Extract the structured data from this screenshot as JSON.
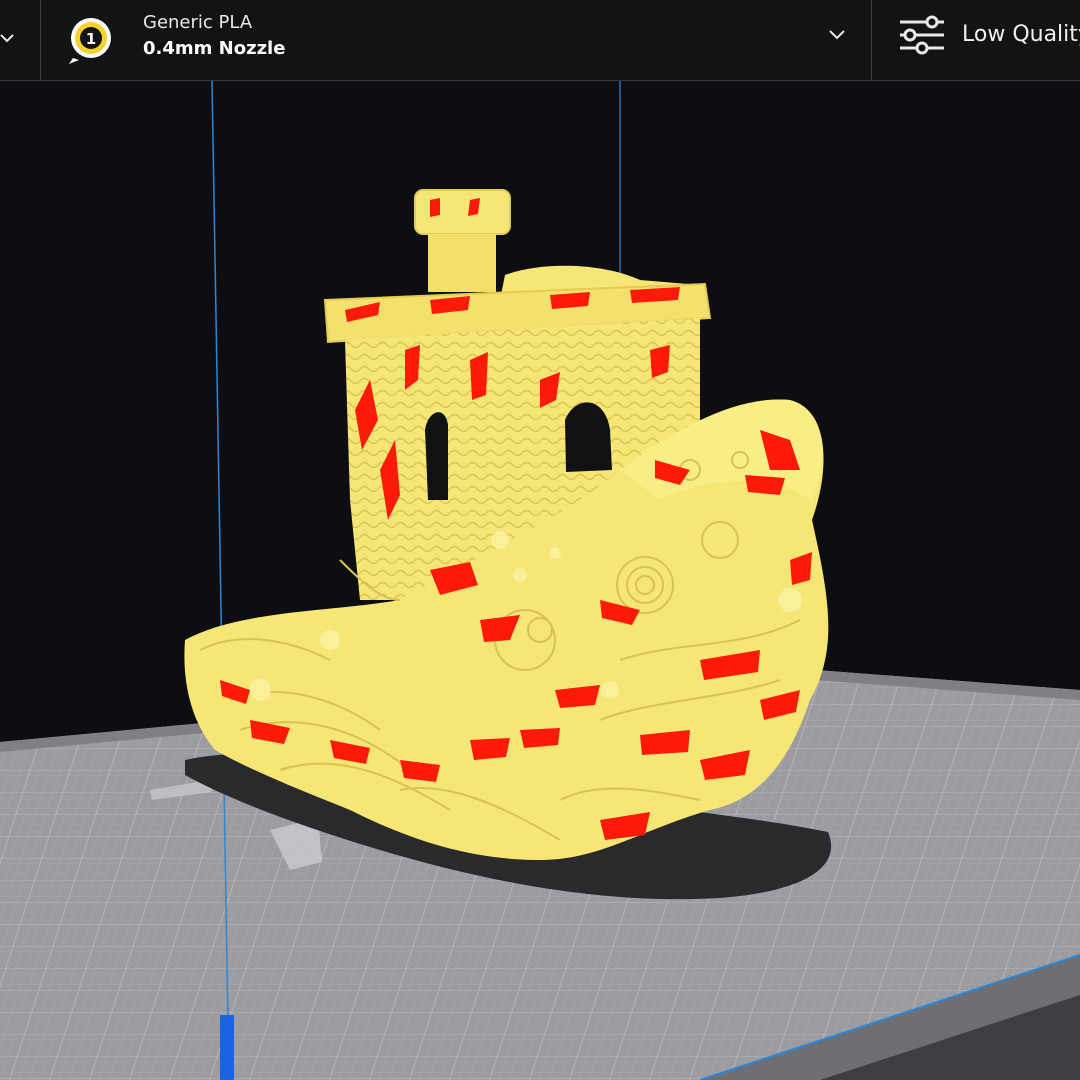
{
  "toolbar": {
    "extruder": {
      "index_label": "1",
      "material_name": "Generic PLA",
      "nozzle_label": "0.4mm Nozzle"
    },
    "quality": {
      "label": "Low Quality",
      "icon": "sliders-icon"
    }
  },
  "viewport": {
    "model_color": "#f6e675",
    "overhang_color": "#ff1a0a",
    "build_plate_color": "#9c9ca0",
    "axis_color": "#2a86d8"
  }
}
